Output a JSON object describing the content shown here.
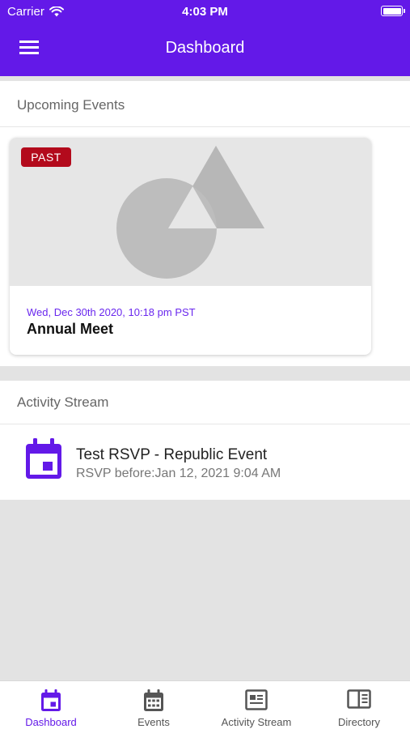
{
  "status_bar": {
    "carrier": "Carrier",
    "time": "4:03 PM"
  },
  "header": {
    "title": "Dashboard",
    "menu_icon": "hamburger-menu-icon"
  },
  "upcoming": {
    "heading": "Upcoming Events",
    "events": [
      {
        "badge": "PAST",
        "date": "Wed, Dec 30th 2020, 10:18 pm PST",
        "title": "Annual Meet",
        "image_icon": "image-placeholder-icon"
      }
    ]
  },
  "activity": {
    "heading": "Activity Stream",
    "items": [
      {
        "icon": "calendar-icon",
        "title": "Test RSVP - Republic Event",
        "subtitle": "RSVP before:Jan 12, 2021 9:04 AM"
      }
    ]
  },
  "tabs": [
    {
      "label": "Dashboard",
      "icon": "calendar-icon",
      "active": true
    },
    {
      "label": "Events",
      "icon": "calendar-grid-icon",
      "active": false
    },
    {
      "label": "Activity Stream",
      "icon": "newspaper-icon",
      "active": false
    },
    {
      "label": "Directory",
      "icon": "book-icon",
      "active": false
    }
  ],
  "colors": {
    "primary": "#6319e8",
    "badge_past": "#b30a1c",
    "date_text": "#6a28ee",
    "background": "#e3e3e3"
  }
}
